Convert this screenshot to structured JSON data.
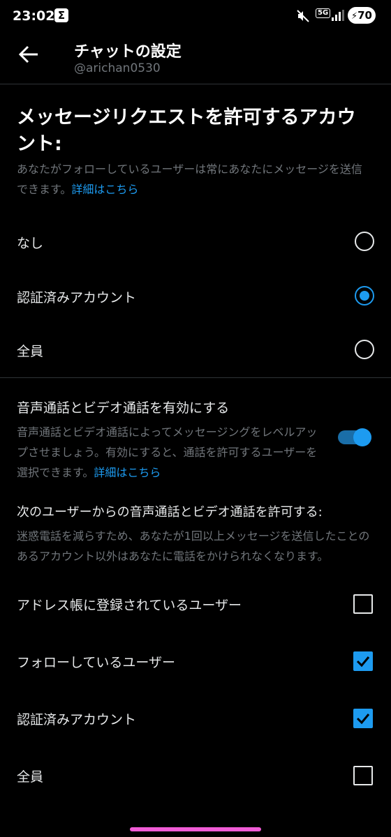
{
  "status_bar": {
    "time": "23:02",
    "app_icon_glyph": "Σ",
    "network": "5G",
    "battery": "70",
    "icons": [
      "mute-icon",
      "signal-icon",
      "battery-charging-icon"
    ]
  },
  "header": {
    "title": "チャットの設定",
    "subtitle": "@arichan0530"
  },
  "message_requests": {
    "heading": "メッセージリクエストを許可するアカウント:",
    "description": "あなたがフォローしているユーザーは常にあなたにメッセージを送信できます。",
    "link": "詳細はこちら",
    "options": [
      {
        "label": "なし",
        "selected": false
      },
      {
        "label": "認証済みアカウント",
        "selected": true
      },
      {
        "label": "全員",
        "selected": false
      }
    ]
  },
  "calls": {
    "title": "音声通話とビデオ通話を有効にする",
    "description": "音声通話とビデオ通話によってメッセージングをレベルアップさせましょう。有効にすると、通話を許可するユーザーを選択できます。",
    "link": "詳細はこちら",
    "enabled": true,
    "allow_title": "次のユーザーからの音声通話とビデオ通話を許可する:",
    "allow_description": "迷惑電話を減らすため、あなたが1回以上メッセージを送信したことのあるアカウント以外はあなたに電話をかけられなくなります。",
    "options": [
      {
        "label": "アドレス帳に登録されているユーザー",
        "checked": false
      },
      {
        "label": "フォローしているユーザー",
        "checked": true
      },
      {
        "label": "認証済みアカウント",
        "checked": true
      },
      {
        "label": "全員",
        "checked": false
      }
    ]
  },
  "colors": {
    "accent": "#1d9bf0",
    "background": "#000000",
    "secondary_text": "#71767b"
  }
}
